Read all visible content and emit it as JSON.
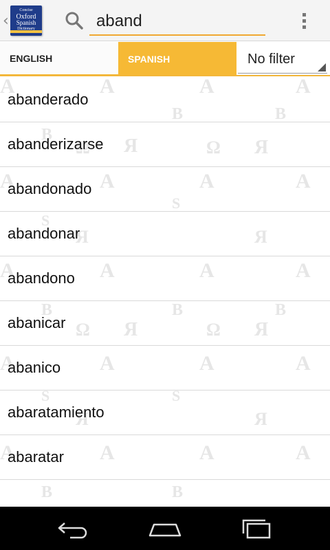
{
  "app": {
    "logo_lines": [
      "Concise",
      "Oxford",
      "Spanish",
      "Dictionary"
    ]
  },
  "search": {
    "value": "aband"
  },
  "tabs": {
    "english": "ENGLISH",
    "spanish": "SPANISH",
    "filter": "No filter"
  },
  "words": [
    "abanderado",
    "abanderizarse",
    "abandonado",
    "abandonar",
    "abandono",
    "abanicar",
    "abanico",
    "abaratamiento",
    "abaratar"
  ],
  "colors": {
    "accent": "#f6b935",
    "action_bar": "#f4f4f4",
    "logo": "#1f3c8a"
  },
  "icons": {
    "search": "search-icon",
    "clear": "close-icon",
    "overflow": "overflow-menu-icon",
    "back": "back-icon",
    "home": "home-icon",
    "recent": "recent-apps-icon"
  }
}
